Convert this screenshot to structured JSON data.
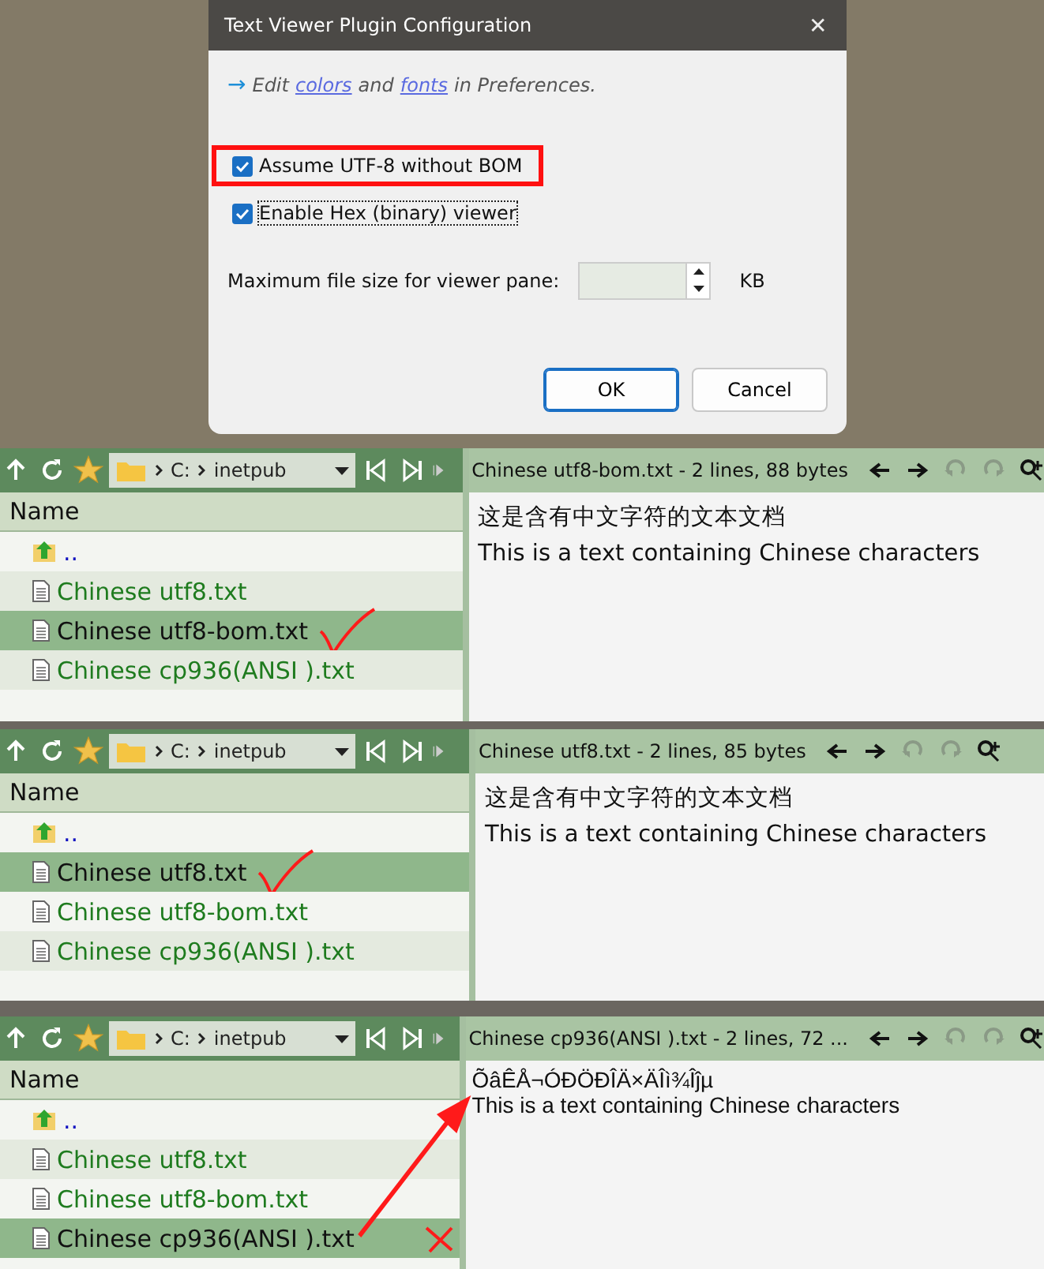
{
  "dialog": {
    "title": "Text Viewer Plugin Configuration",
    "close": "✕",
    "hint": {
      "arrow": "→",
      "parts": [
        {
          "kind": "text",
          "text": "Edit"
        },
        {
          "kind": "link",
          "text": "colors"
        },
        {
          "kind": "text",
          "text": "and"
        },
        {
          "kind": "link",
          "text": "fonts"
        },
        {
          "kind": "text",
          "text": "in Preferences."
        }
      ]
    },
    "checkboxes": [
      {
        "label": "Assume UTF-8 without BOM",
        "checked": true,
        "highlighted": true,
        "focused": false
      },
      {
        "label": "Enable Hex (binary) viewer",
        "checked": true,
        "highlighted": false,
        "focused": true
      }
    ],
    "spinner": {
      "label": "Maximum file size for viewer pane:",
      "unit": "KB"
    },
    "buttons": [
      {
        "label": "OK",
        "default": true
      },
      {
        "label": "Cancel",
        "default": false
      }
    ]
  },
  "panels": [
    {
      "path": [
        "C:",
        "inetpub"
      ],
      "column": "Name",
      "arrow": false,
      "files": [
        {
          "name": "..",
          "kind": "parent",
          "selected": false
        },
        {
          "name": "Chinese utf8.txt",
          "kind": "file",
          "selected": false
        },
        {
          "name": "Chinese utf8-bom.txt",
          "kind": "file",
          "selected": true,
          "tick": true
        },
        {
          "name": "Chinese cp936(ANSI ).txt",
          "kind": "file",
          "selected": false
        }
      ],
      "viewer": {
        "title": "Chinese utf8-bom.txt - 2 lines, 88 bytes",
        "kind": "decoded",
        "lines": [
          "这是含有中文字符的文本文档",
          "This is a text containing Chinese characters"
        ]
      }
    },
    {
      "path": [
        "C:",
        "inetpub"
      ],
      "column": "Name",
      "arrow": false,
      "files": [
        {
          "name": "..",
          "kind": "parent",
          "selected": false
        },
        {
          "name": "Chinese utf8.txt",
          "kind": "file",
          "selected": true,
          "tick": true
        },
        {
          "name": "Chinese utf8-bom.txt",
          "kind": "file",
          "selected": false
        },
        {
          "name": "Chinese cp936(ANSI ).txt",
          "kind": "file",
          "selected": false
        }
      ],
      "viewer": {
        "title": "Chinese utf8.txt - 2 lines, 85 bytes",
        "kind": "decoded",
        "lines": [
          "这是含有中文字符的文本文档",
          "This is a text containing Chinese characters"
        ]
      }
    },
    {
      "path": [
        "C:",
        "inetpub"
      ],
      "column": "Name",
      "arrow": true,
      "files": [
        {
          "name": "..",
          "kind": "parent",
          "selected": false
        },
        {
          "name": "Chinese utf8.txt",
          "kind": "file",
          "selected": false
        },
        {
          "name": "Chinese utf8-bom.txt",
          "kind": "file",
          "selected": false
        },
        {
          "name": "Chinese cp936(ANSI ).txt",
          "kind": "file",
          "selected": true,
          "cross": true
        }
      ],
      "viewer": {
        "title": "Chinese cp936(ANSI ).txt - 2 lines, 72 ...",
        "kind": "raw",
        "lines": [
          "ÕâÊÅ¬ÓÐÖÐÎÄ×ÄÎì¾Îĵµ",
          "This is a text containing Chinese characters"
        ]
      }
    }
  ]
}
